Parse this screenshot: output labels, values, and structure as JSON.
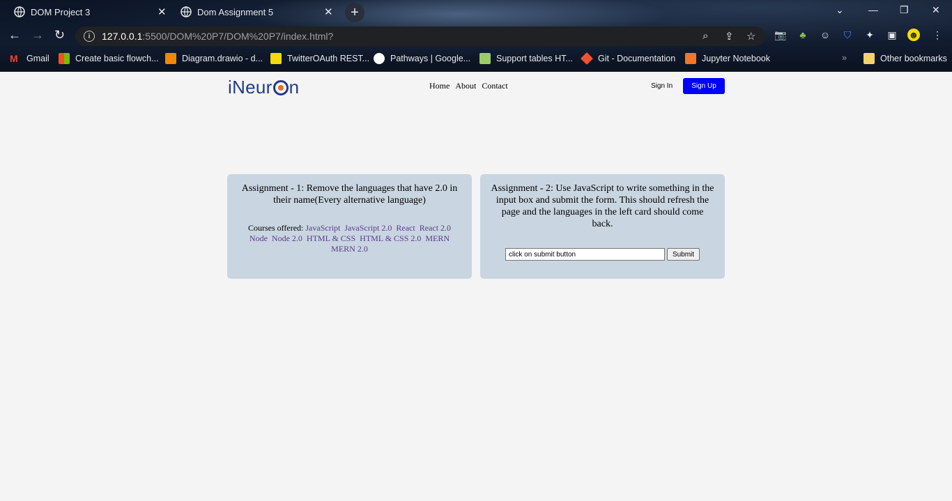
{
  "browser": {
    "tabs": [
      {
        "title": "DOM Project 3",
        "active": false
      },
      {
        "title": "Dom Assignment 5",
        "active": true
      }
    ],
    "url_host": "127.0.0.1",
    "url_path": ":5500/DOM%20P7/DOM%20P7/index.html?",
    "bookmarks": [
      {
        "label": "Gmail",
        "color": "#ea4335"
      },
      {
        "label": "Create basic flowch...",
        "color": "#f25022"
      },
      {
        "label": "Diagram.drawio - d...",
        "color": "#f08705"
      },
      {
        "label": "TwitterOAuth REST...",
        "color": "#f5d90a"
      },
      {
        "label": "Pathways | Google...",
        "color": "#ffffff"
      },
      {
        "label": "Support tables HT...",
        "color": "#9ccc65"
      },
      {
        "label": "Git - Documentation",
        "color": "#f05133"
      },
      {
        "label": "Jupyter Notebook",
        "color": "#f37626"
      }
    ],
    "other_bookmarks": "Other bookmarks"
  },
  "header": {
    "logo_text_before": "iNeur",
    "logo_text_after": "n",
    "nav": [
      "Home",
      "About",
      "Contact"
    ],
    "sign_in": "Sign In",
    "sign_up": "Sign Up",
    "accent_color": "#0000ff"
  },
  "card1": {
    "title": "Assignment - 1: Remove the languages that have 2.0 in their name(Every alternative language)",
    "courses_label": "Courses offered:",
    "languages": [
      "JavaScript",
      "JavaScript 2.0",
      "React",
      "React 2.0",
      "Node",
      "Node 2.0",
      "HTML & CSS",
      "HTML & CSS 2.0",
      "MERN",
      "MERN 2.0"
    ]
  },
  "card2": {
    "title": "Assignment - 2: Use JavaScript to write something in the input box and submit the form. This should refresh the page and the languages in the left card should come back.",
    "input_value": "click on submit button",
    "submit_label": "Submit"
  }
}
